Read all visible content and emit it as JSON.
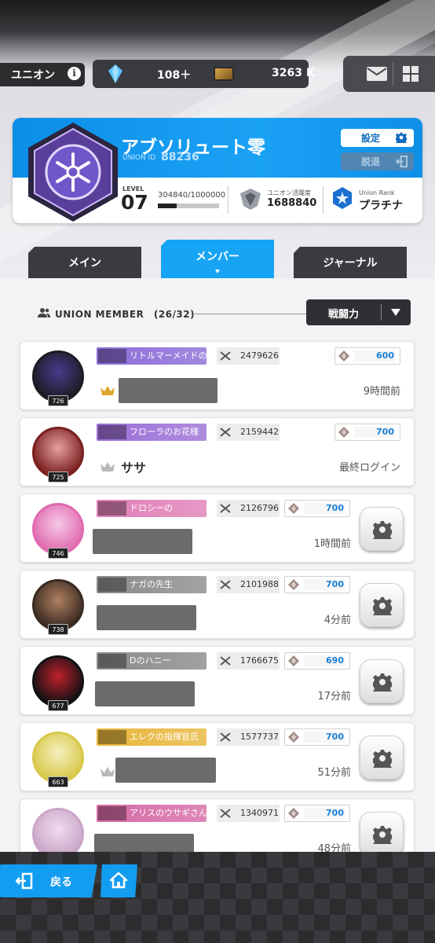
{
  "resources": {
    "union_label": "ユニオン",
    "info_icon": "i",
    "gems": "108＋",
    "tickets": "3263 K"
  },
  "union": {
    "name": "アブソリュート零",
    "id_label": "UNION ID",
    "id": "88236",
    "settings_label": "設定",
    "leave_label": "脱退",
    "level_label": "LEVEL",
    "level": "07",
    "exp": "304840/1000000",
    "exp_fraction": 0.3048,
    "activity_label": "ユニオン活躍度",
    "activity": "1688840",
    "rank_label": "Union Rank",
    "rank": "プラチナ"
  },
  "tabs": [
    {
      "label": "メイン"
    },
    {
      "label": "メンバー"
    },
    {
      "label": "ジャーナル"
    }
  ],
  "members_header": {
    "label": "UNION MEMBER　(26/32)",
    "sort_label": "戦闘力"
  },
  "members": [
    {
      "level": "726",
      "nickname": "リトルマーメイドの王子様",
      "power": "2479626",
      "contribution": "600",
      "name": "",
      "login": "9時間前",
      "banner_color": "#8c6bd8",
      "crown": "gold"
    },
    {
      "level": "725",
      "nickname": "フローラのお花様",
      "power": "2159442",
      "contribution": "700",
      "name": "ササ",
      "login": "最終ログイン",
      "banner_color": "#9b6fd6",
      "crown": "silver"
    },
    {
      "level": "746",
      "nickname": "ドロシーの",
      "power": "2126796",
      "contribution": "700",
      "name": "",
      "login": "1時間前",
      "banner_color": "#e07fb7",
      "crown": ""
    },
    {
      "level": "738",
      "nickname": "ナガの先生",
      "power": "2101988",
      "contribution": "700",
      "name": "",
      "login": "4分前",
      "banner_color": "#8b8b8b",
      "crown": ""
    },
    {
      "level": "677",
      "nickname": "Dのハニー",
      "power": "1766675",
      "contribution": "690",
      "name": "",
      "login": "17分前",
      "banner_color": "#8a8a8a",
      "crown": ""
    },
    {
      "level": "663",
      "nickname": "エレクの指揮官氏",
      "power": "1577737",
      "contribution": "700",
      "name": "",
      "login": "51分前",
      "banner_color": "#e8b63a",
      "crown": "silver"
    },
    {
      "level": "",
      "nickname": "アリスのウサギさん",
      "power": "1340971",
      "contribution": "700",
      "name": "",
      "login": "48分前",
      "banner_color": "#d66aa6",
      "crown": ""
    }
  ],
  "bottom": {
    "back_label": "戻る"
  },
  "colors": {
    "accent": "#17a4f4",
    "dark": "#3a3b40",
    "contribution_text": "#1b7fd8"
  }
}
